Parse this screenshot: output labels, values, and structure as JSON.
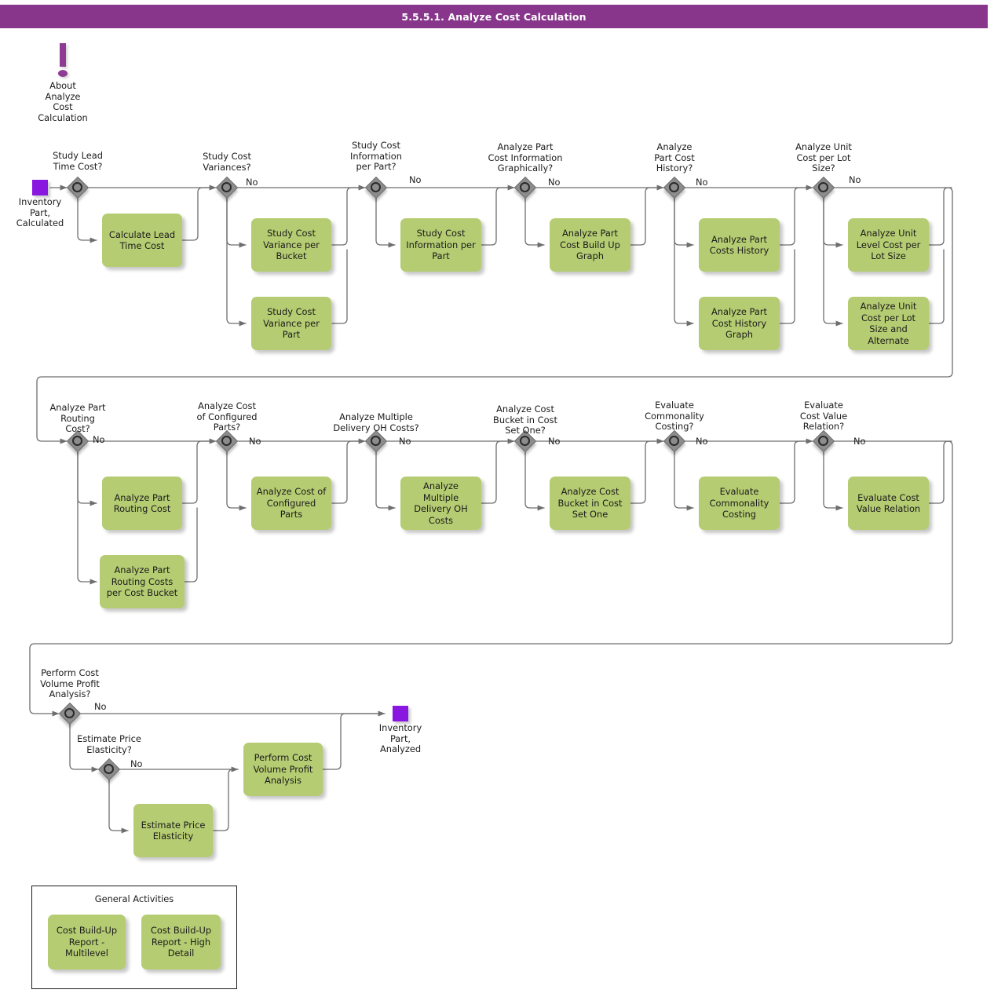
{
  "header": {
    "title": "5.5.5.1. Analyze Cost Calculation",
    "bg_color": "#87368c",
    "text_color": "#ffffff"
  },
  "colors": {
    "task_fill": "#b5cc72",
    "gateway_fill": "#8c8c8c",
    "event_fill": "#8a17e0",
    "annotation": "#8e3c93",
    "connector": "#6e6e6e"
  },
  "annotation": {
    "icon": "exclamation-icon",
    "label": "About\nAnalyze\nCost\nCalculation"
  },
  "events": {
    "start": {
      "label": "Inventory\nPart,\nCalculated"
    },
    "end": {
      "label": "Inventory\nPart,\nAnalyzed"
    }
  },
  "default_branch_label": "No",
  "rows": [
    {
      "id": "row-1",
      "gateways": [
        {
          "id": "gw-study-lead-time-cost",
          "label": "Study Lead\nTime Cost?",
          "branch_label": "",
          "tasks": [
            {
              "id": "task-calculate-lead-time-cost",
              "label": "Calculate Lead\nTime Cost"
            }
          ]
        },
        {
          "id": "gw-study-cost-variances",
          "label": "Study Cost\nVariances?",
          "branch_label": "No",
          "tasks": [
            {
              "id": "task-study-cost-variance-per-bucket",
              "label": "Study Cost\nVariance per\nBucket"
            },
            {
              "id": "task-study-cost-variance-per-part",
              "label": "Study Cost\nVariance per\nPart"
            }
          ]
        },
        {
          "id": "gw-study-cost-information-per-part",
          "label": "Study Cost\nInformation\nper Part?",
          "branch_label": "No",
          "tasks": [
            {
              "id": "task-study-cost-information-per-part",
              "label": "Study Cost\nInformation per\nPart"
            }
          ]
        },
        {
          "id": "gw-analyze-part-cost-information-graphically",
          "label": "Analyze Part\nCost Information\nGraphically?",
          "branch_label": "No",
          "tasks": [
            {
              "id": "task-analyze-part-cost-build-up-graph",
              "label": "Analyze Part\nCost Build Up\nGraph"
            }
          ]
        },
        {
          "id": "gw-analyze-part-cost-history",
          "label": "Analyze\nPart Cost\nHistory?",
          "branch_label": "No",
          "tasks": [
            {
              "id": "task-analyze-part-costs-history",
              "label": "Analyze Part\nCosts History"
            },
            {
              "id": "task-analyze-part-cost-history-graph",
              "label": "Analyze Part\nCost History\nGraph"
            }
          ]
        },
        {
          "id": "gw-analyze-unit-cost-per-lot-size",
          "label": "Analyze Unit\nCost per Lot\nSize?",
          "branch_label": "No",
          "tasks": [
            {
              "id": "task-analyze-unit-level-cost-per-lot-size",
              "label": "Analyze Unit\nLevel Cost per\nLot Size"
            },
            {
              "id": "task-analyze-unit-cost-per-lot-size-and-alternate",
              "label": "Analyze Unit\nCost per Lot\nSize and\nAlternate"
            }
          ]
        }
      ]
    },
    {
      "id": "row-2",
      "gateways": [
        {
          "id": "gw-analyze-part-routing-cost",
          "label": "Analyze Part\nRouting\nCost?",
          "branch_label": "No",
          "tasks": [
            {
              "id": "task-analyze-part-routing-cost",
              "label": "Analyze Part\nRouting Cost"
            },
            {
              "id": "task-analyze-part-routing-costs-per-cost-bucket",
              "label": "Analyze Part\nRouting Costs\nper Cost Bucket"
            }
          ]
        },
        {
          "id": "gw-analyze-cost-of-configured-parts",
          "label": "Analyze Cost\nof Configured\nParts?",
          "branch_label": "No",
          "tasks": [
            {
              "id": "task-analyze-cost-of-configured-parts",
              "label": "Analyze Cost of\nConfigured Parts"
            }
          ]
        },
        {
          "id": "gw-analyze-multiple-delivery-oh-costs",
          "label": "Analyze Multiple\nDelivery OH Costs?",
          "branch_label": "No",
          "tasks": [
            {
              "id": "task-analyze-multiple-delivery-oh-costs",
              "label": "Analyze Multiple\nDelivery OH\nCosts"
            }
          ]
        },
        {
          "id": "gw-analyze-cost-bucket-in-cost-set-one",
          "label": "Analyze Cost\nBucket in Cost\nSet One?",
          "branch_label": "No",
          "tasks": [
            {
              "id": "task-analyze-cost-bucket-in-cost-set-one",
              "label": "Analyze Cost\nBucket in Cost\nSet One"
            }
          ]
        },
        {
          "id": "gw-evaluate-commonality-costing",
          "label": "Evaluate\nCommonality\nCosting?",
          "branch_label": "No",
          "tasks": [
            {
              "id": "task-evaluate-commonality-costing",
              "label": "Evaluate\nCommonality\nCosting"
            }
          ]
        },
        {
          "id": "gw-evaluate-cost-value-relation",
          "label": "Evaluate\nCost Value\nRelation?",
          "branch_label": "No",
          "tasks": [
            {
              "id": "task-evaluate-cost-value-relation",
              "label": "Evaluate Cost\nValue Relation"
            }
          ]
        }
      ]
    },
    {
      "id": "row-3",
      "gateways": [
        {
          "id": "gw-perform-cost-volume-profit-analysis",
          "label": "Perform Cost\nVolume Profit\nAnalysis?",
          "branch_label": "No",
          "tasks": [
            {
              "id": "task-perform-cost-volume-profit-analysis",
              "label": "Perform Cost\nVolume Profit\nAnalysis"
            }
          ]
        },
        {
          "id": "gw-estimate-price-elasticity",
          "label": "Estimate Price\nElasticity?",
          "branch_label": "No",
          "tasks": [
            {
              "id": "task-estimate-price-elasticity",
              "label": "Estimate Price\nElasticity"
            }
          ]
        }
      ]
    }
  ],
  "general_activities": {
    "title": "General Activities",
    "tasks": [
      {
        "id": "task-cost-build-up-report-multilevel",
        "label": "Cost Build-Up\nReport -\nMultilevel"
      },
      {
        "id": "task-cost-build-up-report-high-detail",
        "label": "Cost Build-Up\nReport - High\nDetail"
      }
    ]
  }
}
